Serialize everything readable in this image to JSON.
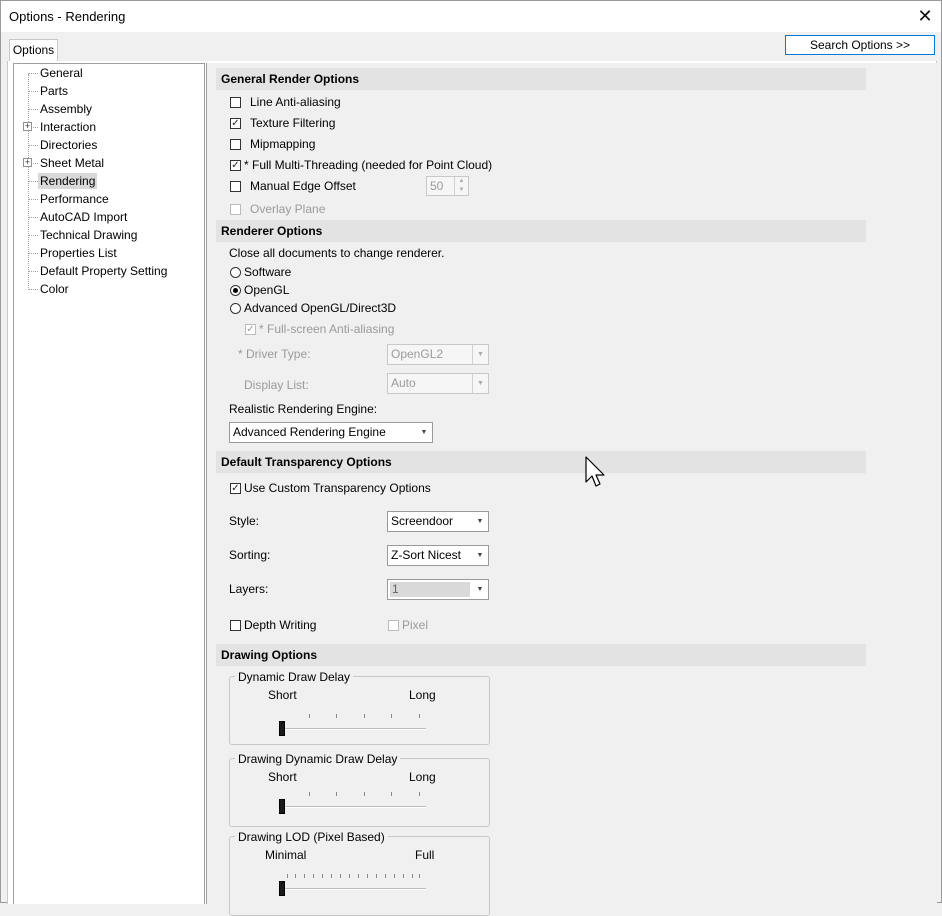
{
  "window": {
    "title": "Options - Rendering",
    "close_glyph": "✕"
  },
  "tabs": {
    "options_label": "Options"
  },
  "search_button_label": "Search Options >>",
  "tree": {
    "items": [
      {
        "label": "General",
        "expandable": false
      },
      {
        "label": "Parts",
        "expandable": false
      },
      {
        "label": "Assembly",
        "expandable": false
      },
      {
        "label": "Interaction",
        "expandable": true
      },
      {
        "label": "Directories",
        "expandable": false
      },
      {
        "label": "Sheet Metal",
        "expandable": true
      },
      {
        "label": "Rendering",
        "expandable": false,
        "selected": true
      },
      {
        "label": "Performance",
        "expandable": false
      },
      {
        "label": "AutoCAD Import",
        "expandable": false
      },
      {
        "label": "Technical Drawing",
        "expandable": false
      },
      {
        "label": "Properties List",
        "expandable": false
      },
      {
        "label": "Default Property Setting",
        "expandable": false
      },
      {
        "label": "Color",
        "expandable": false
      }
    ],
    "expander_glyph": "+"
  },
  "general": {
    "header": "General Render Options",
    "line_antialiasing": {
      "label": "Line Anti-aliasing",
      "checked": false
    },
    "texture_filtering": {
      "label": "Texture Filtering",
      "checked": true
    },
    "mipmapping": {
      "label": "Mipmapping",
      "checked": false
    },
    "multithreading": {
      "label": "* Full Multi-Threading (needed for Point Cloud)",
      "checked": true
    },
    "manual_edge_offset": {
      "label": "Manual Edge Offset",
      "checked": false,
      "value": "50"
    },
    "overlay_plane": {
      "label": "Overlay Plane",
      "checked": false,
      "disabled": true
    }
  },
  "renderer": {
    "header": "Renderer Options",
    "note": "Close all documents to change renderer.",
    "software_label": "Software",
    "opengl_label": "OpenGL",
    "advanced_label": "Advanced OpenGL/Direct3D",
    "selected": "OpenGL",
    "fullscreen_aa_label": "* Full-screen Anti-aliasing",
    "driver_type_label": "* Driver Type:",
    "driver_type_value": "OpenGL2",
    "display_list_label": "Display List:",
    "display_list_value": "Auto",
    "realistic_engine_label": "Realistic Rendering Engine:",
    "realistic_engine_value": "Advanced Rendering Engine"
  },
  "transparency": {
    "header": "Default Transparency Options",
    "use_custom_label": "Use Custom Transparency Options",
    "use_custom_checked": true,
    "style_label": "Style:",
    "style_value": "Screendoor",
    "sorting_label": "Sorting:",
    "sorting_value": "Z-Sort Nicest",
    "layers_label": "Layers:",
    "layers_value": "1",
    "depth_writing_label": "Depth Writing",
    "depth_writing_checked": false,
    "pixel_label": "Pixel",
    "pixel_checked": false
  },
  "drawing": {
    "header": "Drawing Options",
    "dynamic_draw_delay": {
      "title": "Dynamic Draw Delay",
      "min_label": "Short",
      "max_label": "Long",
      "value_fraction": 0.0
    },
    "drawing_dynamic_draw_delay": {
      "title": "Drawing Dynamic Draw Delay",
      "min_label": "Short",
      "max_label": "Long",
      "value_fraction": 0.0
    },
    "drawing_lod": {
      "title": "Drawing LOD (Pixel Based)",
      "min_label": "Minimal",
      "max_label": "Full",
      "value_fraction": 0.0
    }
  },
  "glyphs": {
    "check": "✓",
    "dropdown": "▼",
    "spin_up": "▲",
    "spin_down": "▼"
  }
}
